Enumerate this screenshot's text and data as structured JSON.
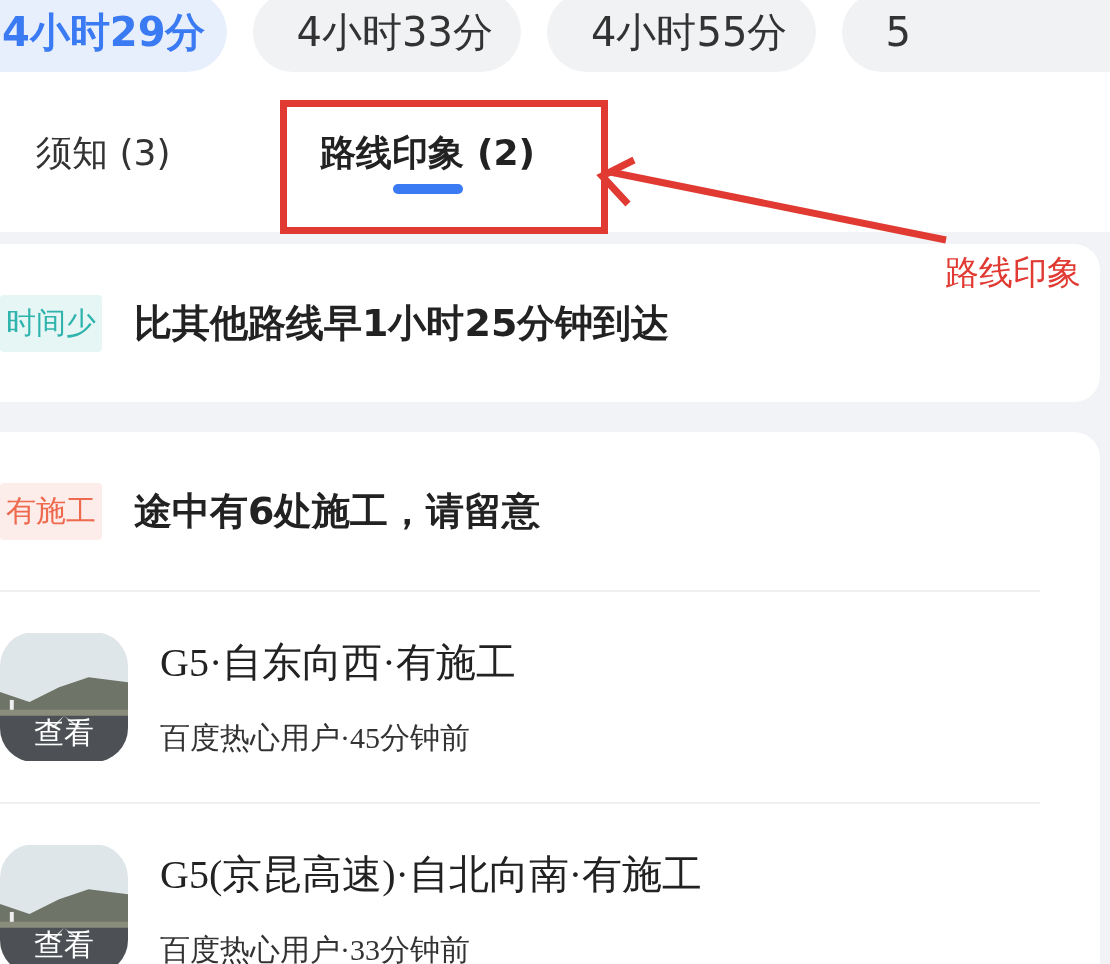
{
  "route_options": [
    {
      "label": "4小时29分",
      "selected": true
    },
    {
      "label": "4小时33分",
      "selected": false
    },
    {
      "label": "4小时55分",
      "selected": false
    },
    {
      "label": "5",
      "selected": false
    }
  ],
  "tabs": [
    {
      "label": "须知 (3)",
      "selected": false
    },
    {
      "label": "路线印象 (2)",
      "selected": true
    }
  ],
  "annotation": {
    "label": "路线印象"
  },
  "cards": [
    {
      "tag": "时间少",
      "color": "#2fb3ad",
      "title": "比其他路线早1小时25分钟到达"
    },
    {
      "tag": "有施工",
      "color": "#ee6a4f",
      "title": "途中有6处施工，请留意",
      "reports": [
        {
          "title": "G5·自东向西·有施工",
          "meta": "百度热心用户·45分钟前",
          "button": "查看",
          "kind": "picture"
        },
        {
          "title": "G5(京昆高速)·自北向南·有施工",
          "meta": "百度热心用户·33分钟前",
          "button": "查看",
          "kind": "picture"
        }
      ]
    }
  ]
}
